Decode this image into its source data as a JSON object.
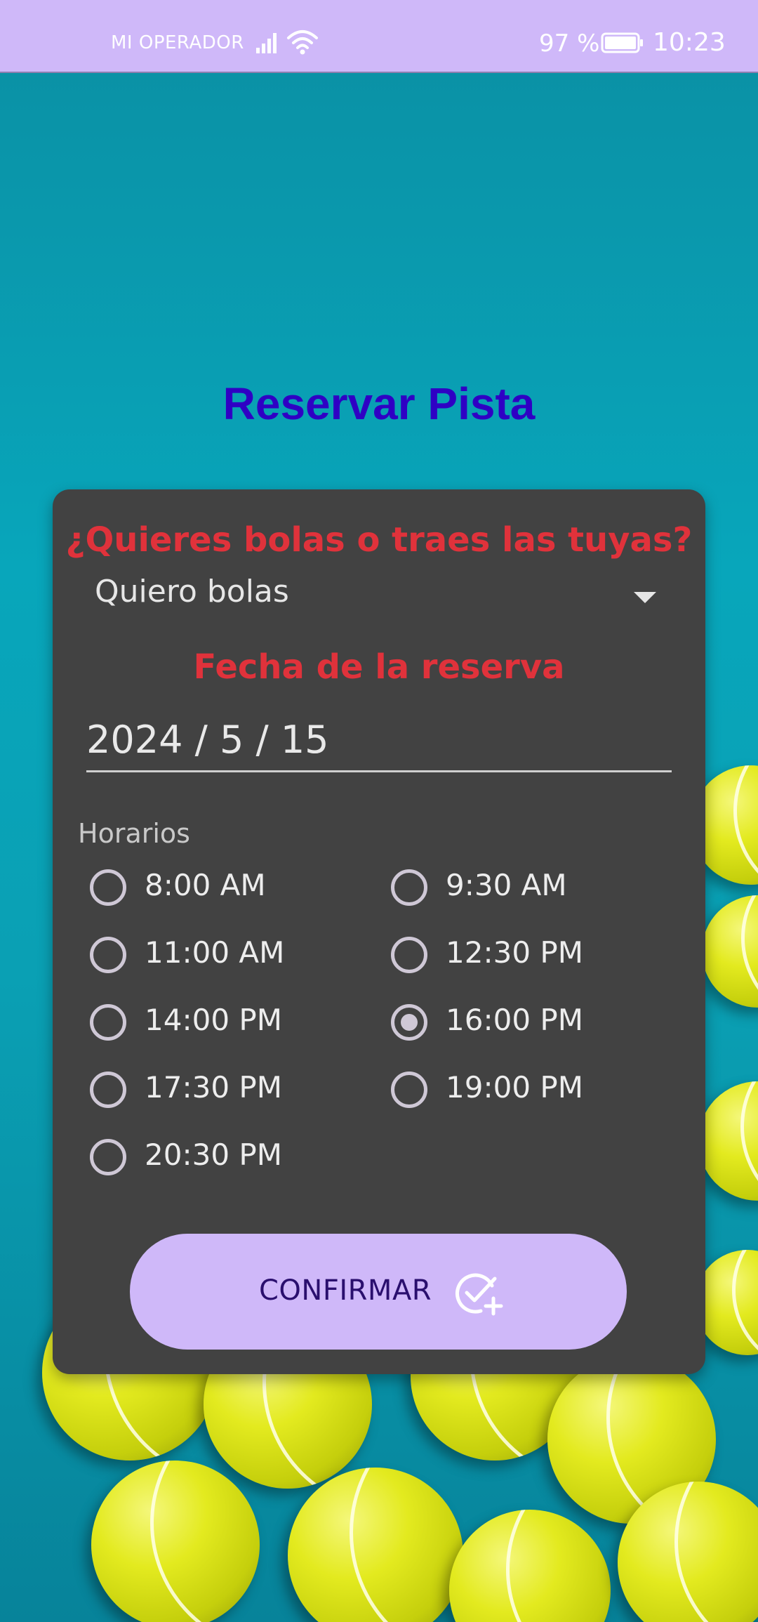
{
  "status_bar": {
    "carrier": "MI OPERADOR",
    "battery_percent": "97 %",
    "time": "10:23",
    "icons": [
      "signal-icon",
      "wifi-icon",
      "battery-icon"
    ]
  },
  "page_title": "Reservar Pista",
  "balls": {
    "question": "¿Quieres bolas o traes las tuyas?",
    "selected": "Quiero bolas"
  },
  "date": {
    "title": "Fecha de la reserva",
    "value": "2024 / 5 / 15"
  },
  "schedule": {
    "label": "Horarios",
    "slots": [
      {
        "label": "8:00 AM",
        "checked": false
      },
      {
        "label": "9:30 AM",
        "checked": false
      },
      {
        "label": "11:00 AM",
        "checked": false
      },
      {
        "label": "12:30 PM",
        "checked": false
      },
      {
        "label": "14:00 PM",
        "checked": false
      },
      {
        "label": "16:00 PM",
        "checked": true
      },
      {
        "label": "17:30 PM",
        "checked": false
      },
      {
        "label": "19:00 PM",
        "checked": false
      },
      {
        "label": "20:30 PM",
        "checked": false
      }
    ]
  },
  "confirm_button": {
    "label": "CONFIRMAR",
    "icon": "check-add-icon"
  },
  "colors": {
    "status_bar": "#cfb8f9",
    "title": "#2f00c4",
    "section_title": "#e0323b",
    "card": "#424242",
    "button": "#cfb8f9",
    "button_text": "#2a0f6e"
  }
}
